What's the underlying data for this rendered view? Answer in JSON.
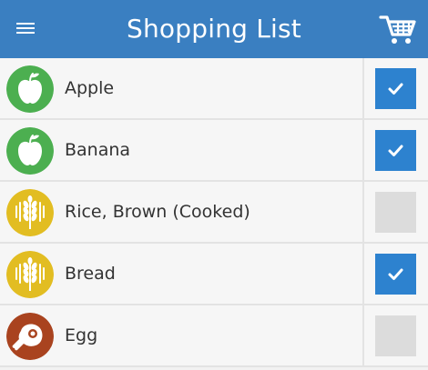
{
  "header": {
    "title": "Shopping List",
    "menu_icon": "hamburger-menu-icon",
    "cart_icon": "shopping-cart-icon",
    "background_color": "#3a7fc1"
  },
  "items": [
    {
      "label": "Apple",
      "icon": "apple-icon",
      "icon_color": "#4caf50",
      "checked": true
    },
    {
      "label": "Banana",
      "icon": "apple-icon",
      "icon_color": "#4caf50",
      "checked": true
    },
    {
      "label": "Rice, Brown (Cooked)",
      "icon": "wheat-icon",
      "icon_color": "#e2bd22",
      "checked": false
    },
    {
      "label": "Bread",
      "icon": "wheat-icon",
      "icon_color": "#e2bd22",
      "checked": true
    },
    {
      "label": "Egg",
      "icon": "meat-icon",
      "icon_color": "#a9431f",
      "checked": false
    }
  ],
  "checkbox_checked_color": "#2d82cf",
  "checkbox_unchecked_color": "#dcdcdc"
}
